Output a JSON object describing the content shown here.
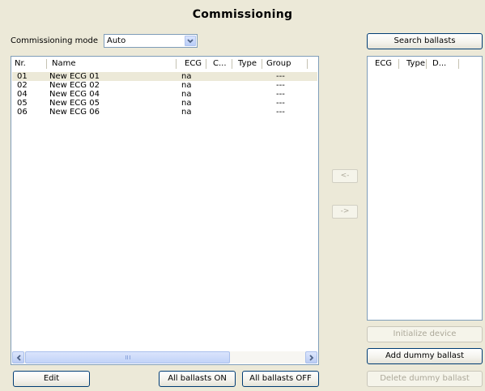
{
  "title": "Commissioning",
  "mode": {
    "label": "Commissioning mode",
    "value": "Auto"
  },
  "main_list": {
    "headers": [
      "Nr.",
      "Name",
      "ECG",
      "C...",
      "Type",
      "Group"
    ],
    "rows": [
      {
        "nr": "01",
        "name": "New ECG 01",
        "ecg": "na",
        "c": "",
        "type": "",
        "group": "---",
        "selected": true
      },
      {
        "nr": "02",
        "name": "New ECG 02",
        "ecg": "na",
        "c": "",
        "type": "",
        "group": "---"
      },
      {
        "nr": "04",
        "name": "New ECG 04",
        "ecg": "na",
        "c": "",
        "type": "",
        "group": "---"
      },
      {
        "nr": "05",
        "name": "New ECG 05",
        "ecg": "na",
        "c": "",
        "type": "",
        "group": "---"
      },
      {
        "nr": "06",
        "name": "New ECG 06",
        "ecg": "na",
        "c": "",
        "type": "",
        "group": "---"
      }
    ]
  },
  "right_list": {
    "headers": [
      "ECG",
      "Type",
      "D..."
    ]
  },
  "buttons": {
    "search": "Search ballasts",
    "move_left": "<-",
    "move_right": "->",
    "initialize": "Initialize device",
    "add_dummy": "Add dummy ballast",
    "delete_dummy": "Delete dummy ballast",
    "edit": "Edit",
    "all_on": "All ballasts ON",
    "all_off": "All ballasts OFF"
  },
  "icons": {
    "dropdown": "chevron-down-icon",
    "scroll_left": "scroll-left-icon",
    "scroll_right": "scroll-right-icon"
  }
}
